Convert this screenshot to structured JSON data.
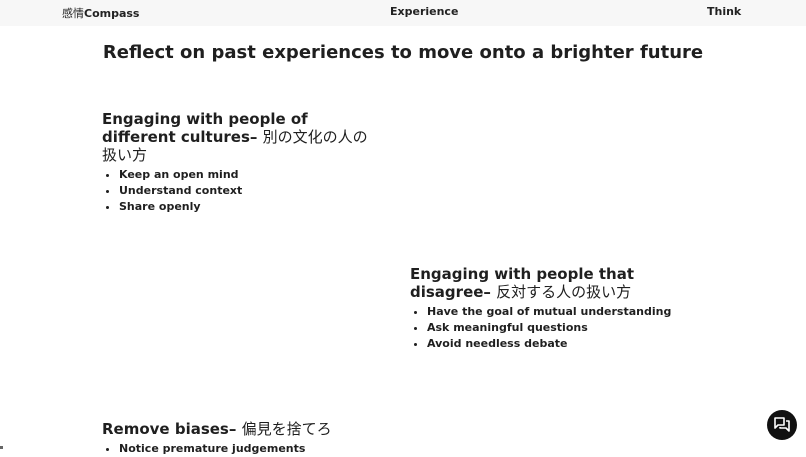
{
  "header": {
    "brand_jp": "感情",
    "brand_en": "Compass",
    "nav": [
      "Experience",
      "Think"
    ]
  },
  "page_title": "Reflect on past experiences to move onto a brighter future",
  "sections": [
    {
      "title_en": "Engaging with people of different cultures–",
      "title_jp": "別の文化の人の扱い方",
      "items": [
        "Keep an open mind",
        "Understand context",
        "Share openly"
      ]
    },
    {
      "title_en": "Engaging with people that disagree–",
      "title_jp": "反対する人の扱い方",
      "items": [
        "Have the goal of mutual understanding",
        "Ask meaningful questions",
        "Avoid needless debate"
      ]
    },
    {
      "title_en": "Remove biases–",
      "title_jp": "偏見を捨てろ",
      "items": [
        "Notice premature judgements"
      ]
    }
  ],
  "chat": {
    "icon": "chat-bubbles-icon"
  }
}
